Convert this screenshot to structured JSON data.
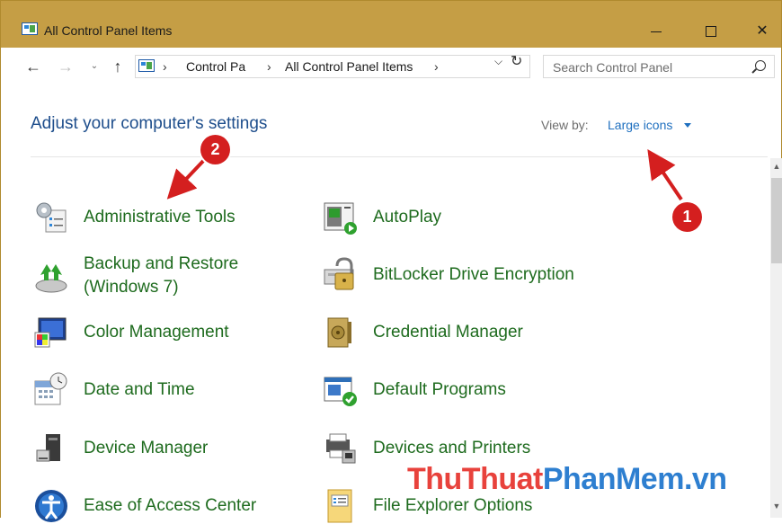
{
  "window": {
    "title": "All Control Panel Items"
  },
  "address": {
    "crumbs": [
      "Control Pa",
      "All Control Panel Items"
    ]
  },
  "search": {
    "placeholder": "Search Control Panel"
  },
  "header": {
    "title": "Adjust your computer's settings",
    "view_by_label": "View by:",
    "view_by_value": "Large icons"
  },
  "items": [
    {
      "label": "Administrative Tools",
      "icon": "administrative-tools-icon"
    },
    {
      "label": "AutoPlay",
      "icon": "autoplay-icon"
    },
    {
      "label": "Backup and Restore",
      "label2": "(Windows 7)",
      "icon": "backup-restore-icon"
    },
    {
      "label": "BitLocker Drive Encryption",
      "icon": "bitlocker-icon"
    },
    {
      "label": "Color Management",
      "icon": "color-management-icon"
    },
    {
      "label": "Credential Manager",
      "icon": "credential-manager-icon"
    },
    {
      "label": "Date and Time",
      "icon": "date-time-icon"
    },
    {
      "label": "Default Programs",
      "icon": "default-programs-icon"
    },
    {
      "label": "Device Manager",
      "icon": "device-manager-icon"
    },
    {
      "label": "Devices and Printers",
      "icon": "devices-printers-icon"
    },
    {
      "label": "Ease of Access Center",
      "icon": "ease-of-access-icon"
    },
    {
      "label": "File Explorer Options",
      "icon": "file-explorer-options-icon"
    }
  ],
  "annotations": {
    "badge1": "1",
    "badge2": "2"
  },
  "watermark": {
    "part1": "ThuThuat",
    "part2": "PhanMem",
    "part3": ".vn"
  },
  "colors": {
    "titlebar": "#c59e45",
    "link": "#1e6fbf",
    "item_text": "#1e6b1e",
    "badge": "#d41f1f"
  }
}
